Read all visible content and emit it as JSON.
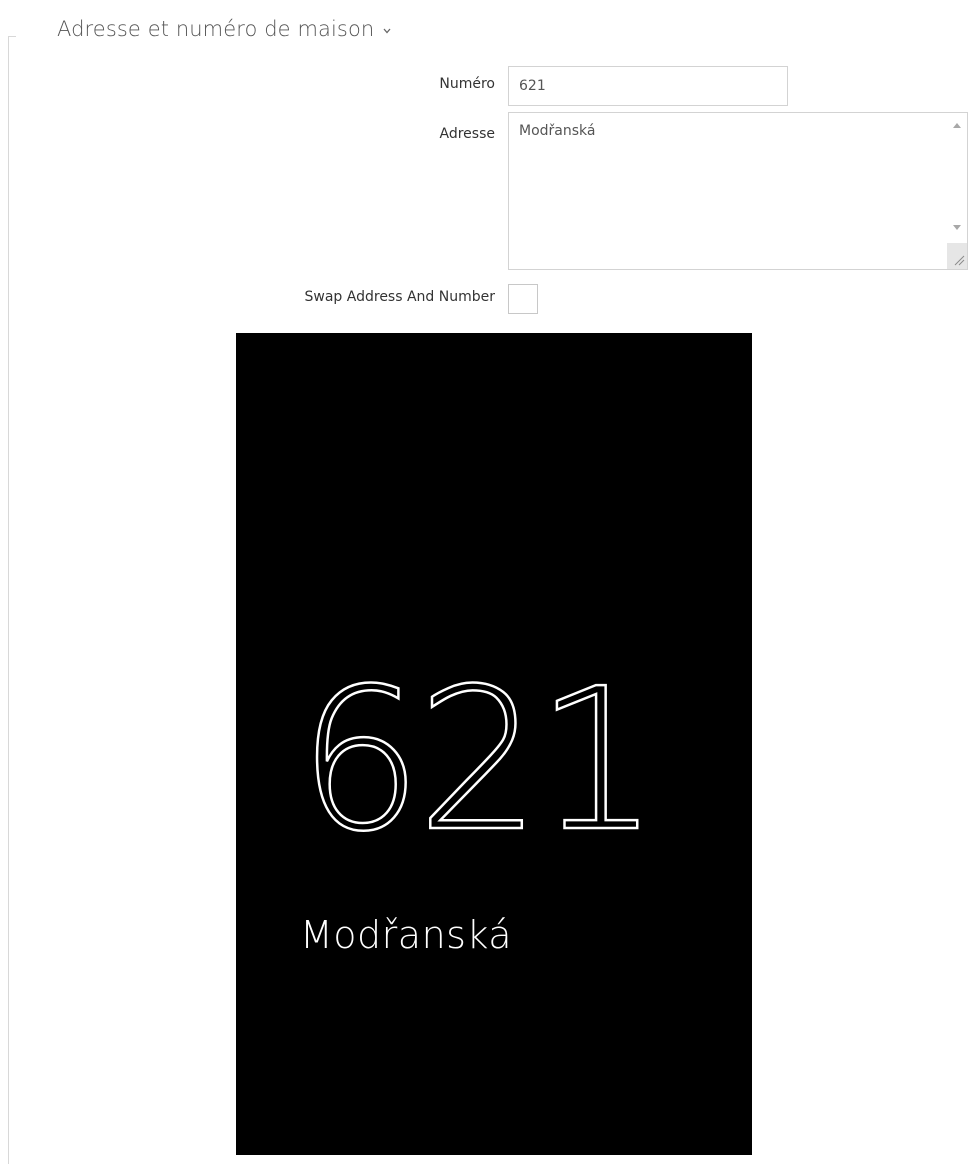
{
  "section": {
    "title": "Adresse et numéro de maison",
    "chevron_icon": "chevron-down-icon"
  },
  "form": {
    "number_label": "Numéro",
    "number_value": "621",
    "address_label": "Adresse",
    "address_value": "Modřanská",
    "swap_label": "Swap Address And Number",
    "swap_checked": false
  },
  "preview": {
    "number": "621",
    "address": "Modřanská",
    "background": "#000000",
    "text_color": "#ffffff"
  }
}
